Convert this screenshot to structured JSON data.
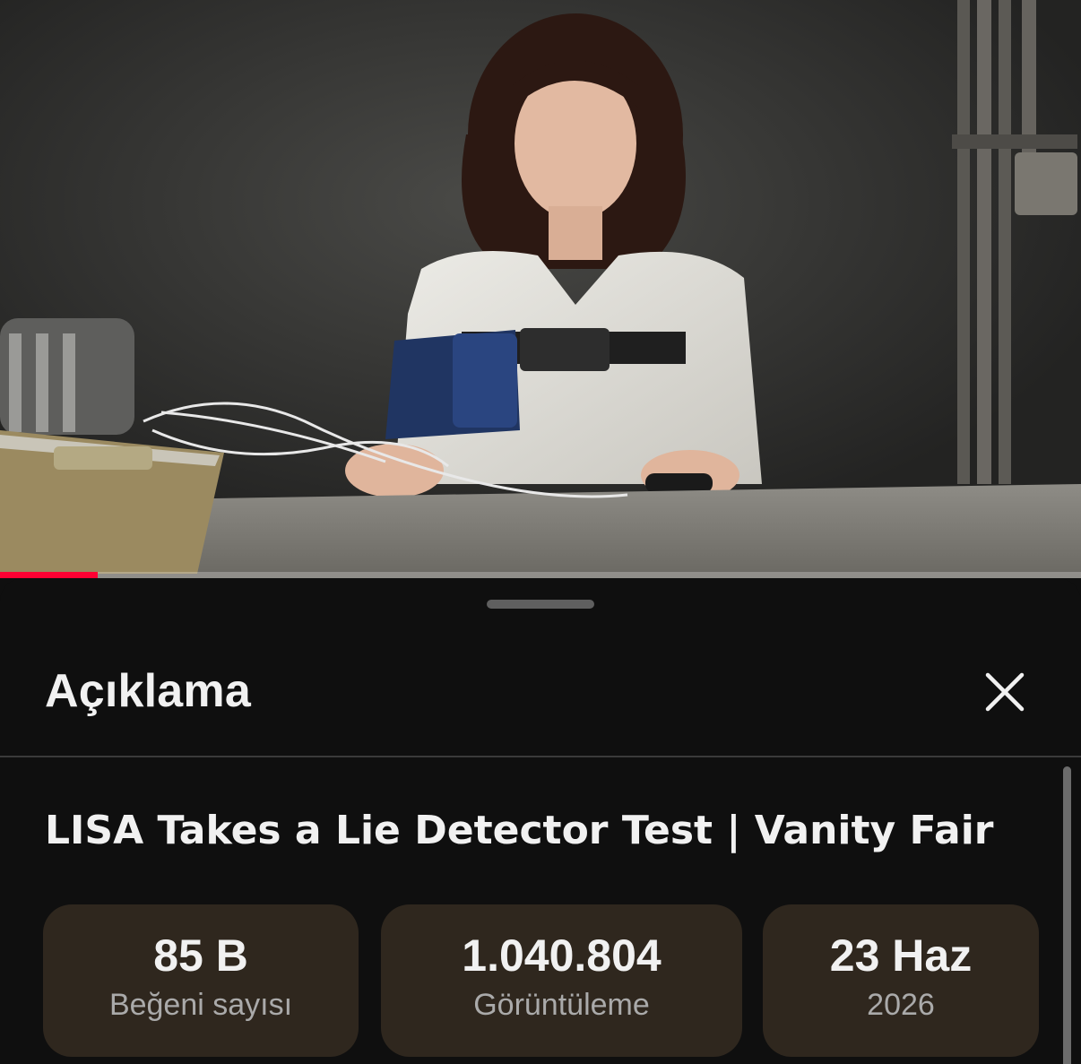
{
  "video": {
    "progress_fraction": 0.09,
    "progress_color": "#ff0033"
  },
  "sheet": {
    "title": "Açıklama",
    "close_icon": "close-icon"
  },
  "description": {
    "video_title": "LISA Takes a Lie Detector Test | Vanity Fair",
    "stats": {
      "likes": {
        "value": "85 B",
        "label": "Beğeni sayısı"
      },
      "views": {
        "value": "1.040.804",
        "label": "Görüntüleme"
      },
      "date": {
        "value": "23 Haz",
        "label": "2026"
      }
    }
  },
  "colors": {
    "background": "#0f0f0f",
    "stat_chip": "#2f271e",
    "primary_text": "#f1f1f1",
    "secondary_text": "#aaaaaa"
  }
}
